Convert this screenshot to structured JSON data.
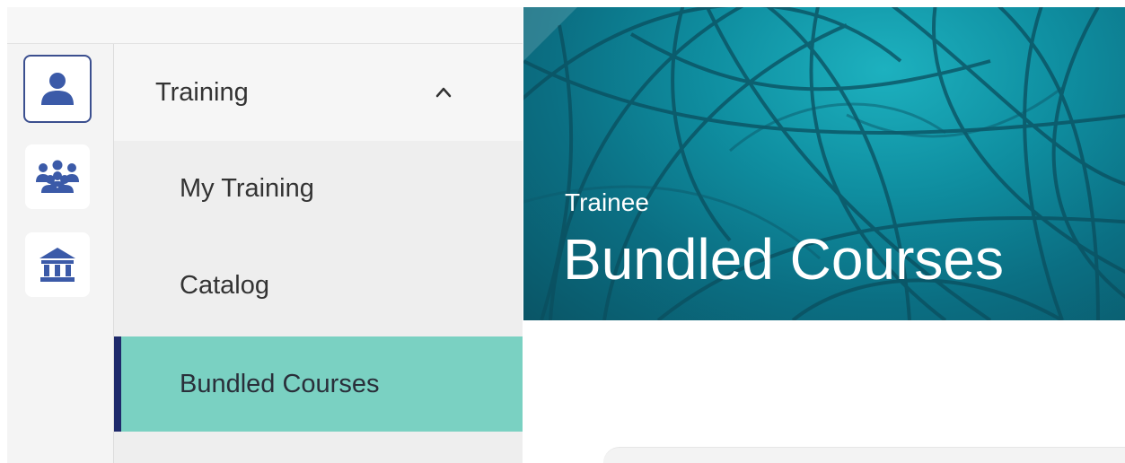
{
  "rail": {
    "items": [
      {
        "icon": "user-icon",
        "active": true
      },
      {
        "icon": "group-icon",
        "active": false
      },
      {
        "icon": "institution-icon",
        "active": false
      }
    ],
    "icon_color": "#3b5aa8"
  },
  "nav": {
    "section_label": "Training",
    "section_expanded": true,
    "items": [
      {
        "label": "My Training",
        "active": false
      },
      {
        "label": "Catalog",
        "active": false
      },
      {
        "label": "Bundled Courses",
        "active": true
      }
    ],
    "active_bg": "#7ad1c2",
    "active_border": "#1f2a6b"
  },
  "hero": {
    "subtitle": "Trainee",
    "title": "Bundled Courses",
    "colors": {
      "teal_light": "#1db1bf",
      "teal_dark": "#0a5566"
    }
  }
}
